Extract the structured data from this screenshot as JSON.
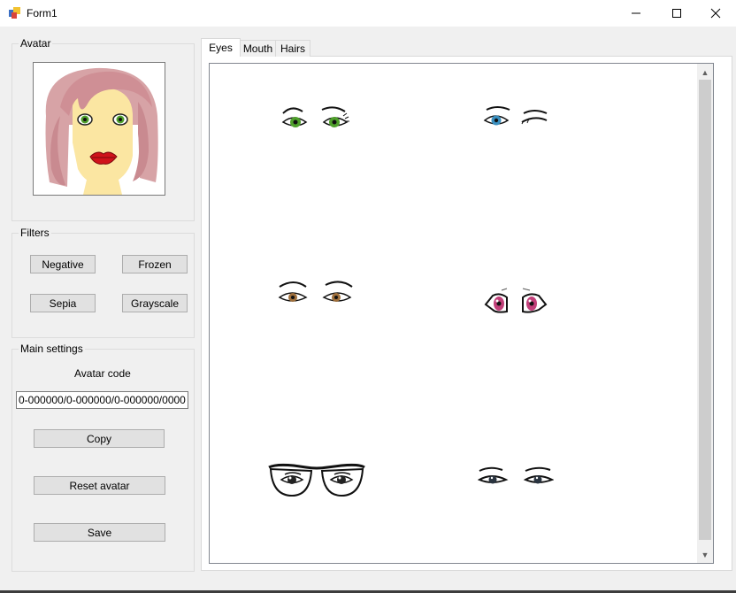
{
  "window": {
    "title": "Form1",
    "minimize_glyph": "—",
    "maximize_glyph": "☐",
    "close_glyph": "✕"
  },
  "avatar_group": {
    "label": "Avatar"
  },
  "filters": {
    "label": "Filters",
    "negative": "Negative",
    "frozen": "Frozen",
    "sepia": "Sepia",
    "grayscale": "Grayscale"
  },
  "main_settings": {
    "label": "Main settings",
    "code_label": "Avatar code",
    "code_value": "0-000000/0-000000/0-000000/0000",
    "copy": "Copy",
    "reset": "Reset avatar",
    "save": "Save"
  },
  "tabs": [
    {
      "label": "Eyes",
      "active": true
    },
    {
      "label": "Mouth",
      "active": false
    },
    {
      "label": "Hairs",
      "active": false
    }
  ],
  "eyes_options": [
    {
      "name": "green-eyes",
      "iris_color": "#4fa02c"
    },
    {
      "name": "blue-winking-eyes",
      "iris_color": "#3a8fbf"
    },
    {
      "name": "brown-eyes",
      "iris_color": "#a0703c"
    },
    {
      "name": "pink-anime-eyes",
      "iris_color": "#c2407a"
    },
    {
      "name": "glasses-eyes",
      "iris_color": "#222222"
    },
    {
      "name": "dark-lined-eyes",
      "iris_color": "#2a3440"
    }
  ],
  "scrollbar": {
    "up_glyph": "▲",
    "down_glyph": "▼"
  }
}
